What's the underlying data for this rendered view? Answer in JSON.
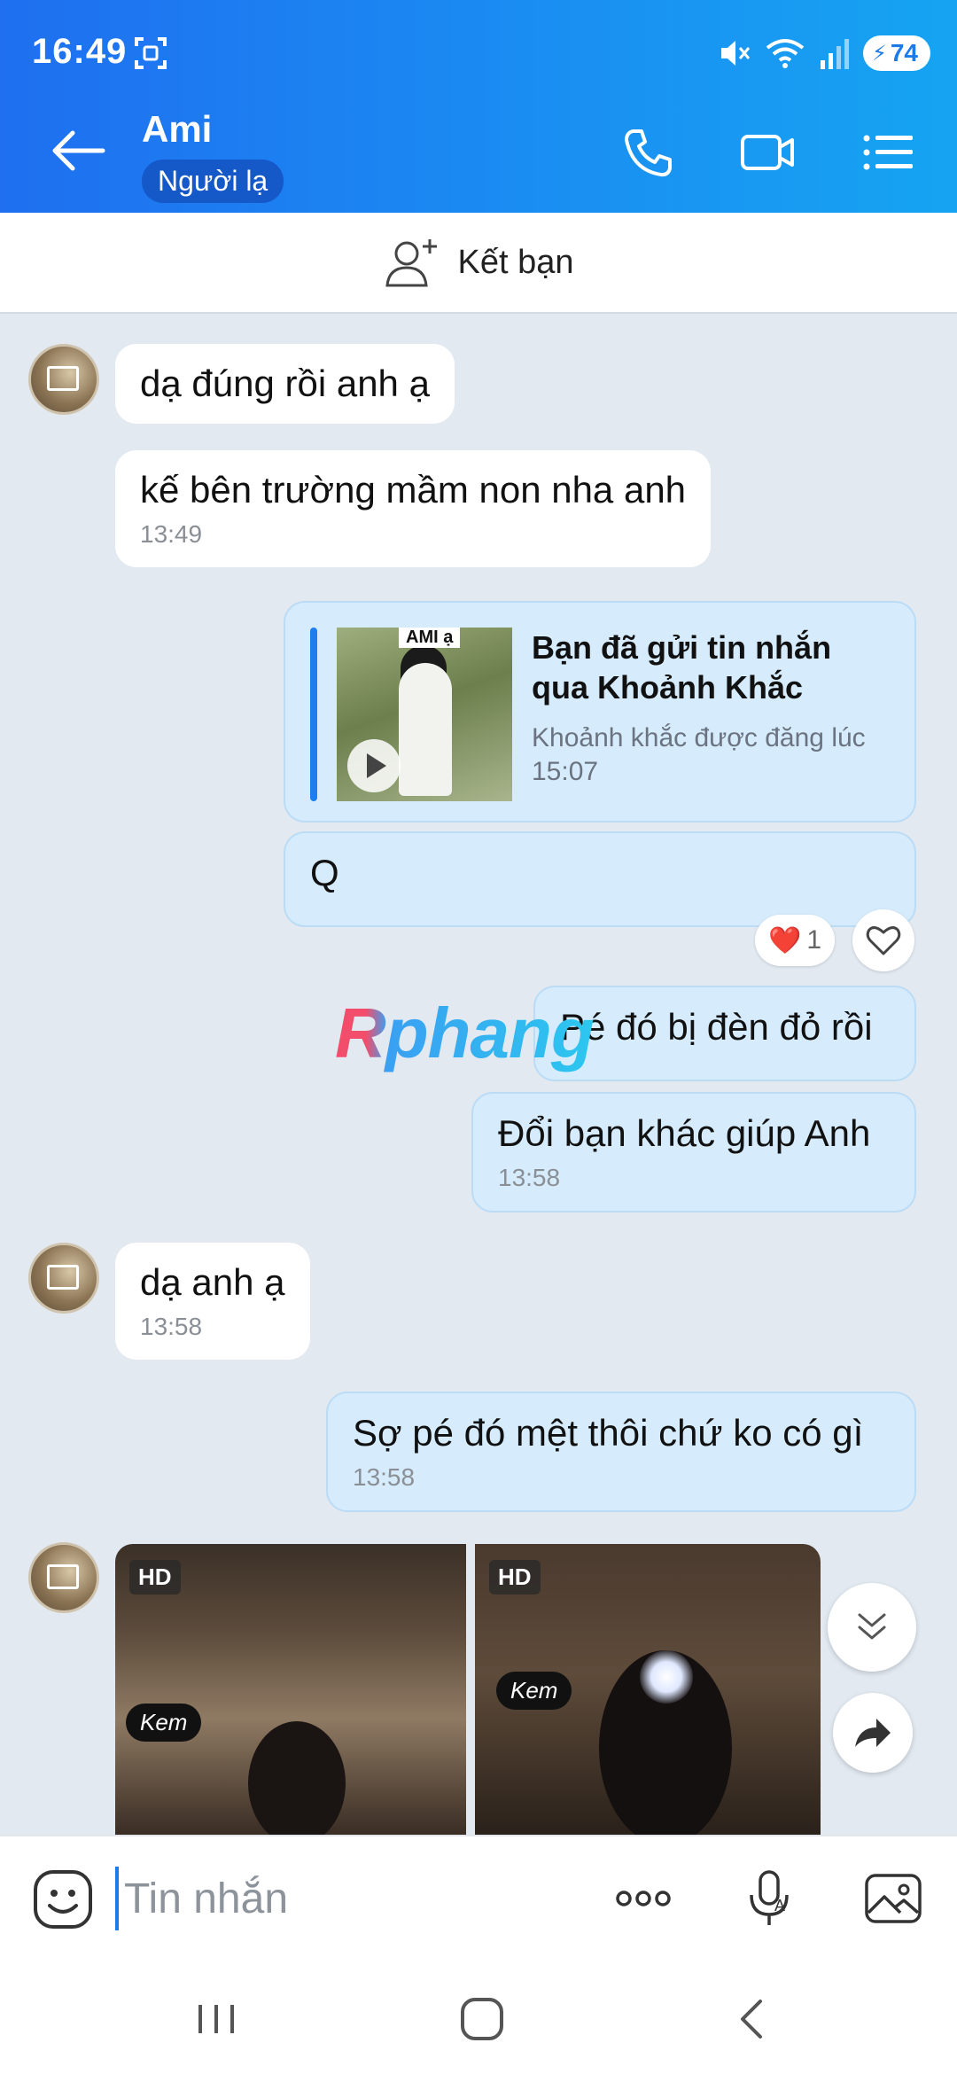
{
  "status_bar": {
    "time": "16:49",
    "battery": "74",
    "icons": [
      "screenshot-icon",
      "mute-icon",
      "wifi-icon",
      "signal-icon",
      "battery-icon"
    ]
  },
  "header": {
    "contact_name": "Ami",
    "contact_badge": "Người lạ",
    "icons": [
      "back-arrow-icon",
      "phone-icon",
      "video-call-icon",
      "menu-list-icon"
    ]
  },
  "add_friend": {
    "label": "Kết bạn",
    "icon": "add-user-icon"
  },
  "messages": [
    {
      "from": "them",
      "text": "dạ đúng rồi anh ạ"
    },
    {
      "from": "them",
      "text": "kế bên trường mầm non nha anh",
      "time": "13:49"
    },
    {
      "from": "me",
      "type": "moment",
      "thumb_tag": "AMI ạ",
      "title": "Bạn đã gửi tin nhắn qua Khoảnh Khắc",
      "subtitle": "Khoảnh khắc được đăng lúc 15:07"
    },
    {
      "from": "me",
      "text": "Q",
      "reaction": {
        "emoji": "❤️",
        "count": "1"
      }
    },
    {
      "from": "me",
      "text": "Pé đó bị đèn đỏ rồi"
    },
    {
      "from": "me",
      "text": "Đổi bạn khác giúp Anh",
      "time": "13:58"
    },
    {
      "from": "them",
      "text": "dạ anh ạ",
      "time": "13:58"
    },
    {
      "from": "me",
      "text": "Sợ pé đó mệt thôi chứ ko có gì",
      "time": "13:58"
    },
    {
      "from": "them",
      "type": "photos",
      "photos": [
        {
          "badge": "HD",
          "caption": "Kem"
        },
        {
          "badge": "HD",
          "caption": "Kem"
        }
      ]
    }
  ],
  "watermark": "Rphang",
  "floating_buttons": [
    "scroll-down-icon",
    "share-forward-icon"
  ],
  "composer": {
    "placeholder": "Tin nhắn",
    "icons": [
      "emoji-icon",
      "more-dots-icon",
      "voice-mic-icon",
      "image-gallery-icon"
    ]
  },
  "nav_bar": {
    "icons": [
      "recent-apps-icon",
      "home-icon",
      "back-icon"
    ]
  },
  "colors": {
    "header_start": "#1f6ff0",
    "header_end": "#16a4f2",
    "out_bubble": "#d6ecfd",
    "in_bubble": "#ffffff",
    "chat_bg": "#e2e9f1",
    "accent": "#1a7be9"
  }
}
